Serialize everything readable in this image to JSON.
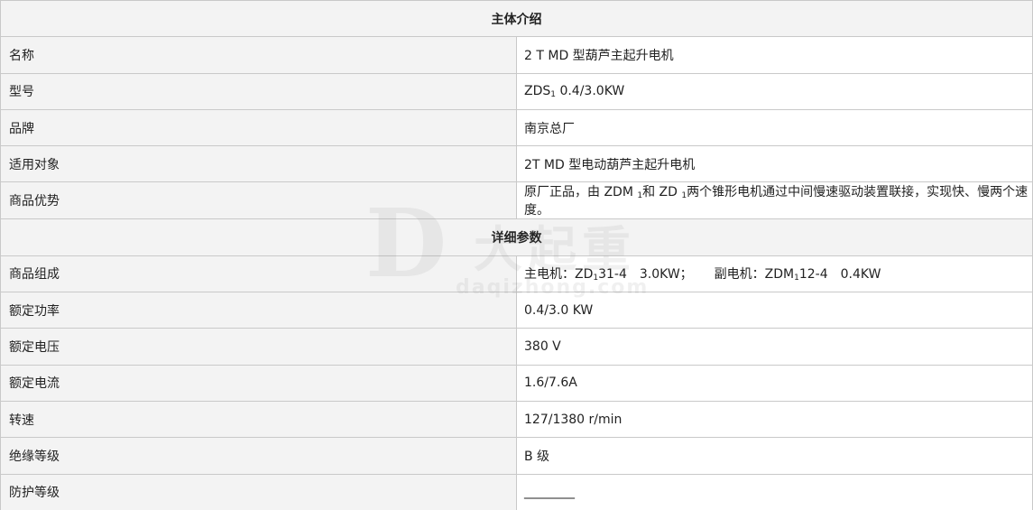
{
  "sections": {
    "intro_title": "主体介绍",
    "params_title": "详细参数"
  },
  "intro_rows": [
    {
      "label": "名称",
      "value": "2 T MD 型葫芦主起升电机"
    },
    {
      "label": "型号",
      "value_pre": "ZDS",
      "value_sub": "1",
      "value_post": " 0.4/3.0KW"
    },
    {
      "label": "品牌",
      "value": "南京总厂"
    },
    {
      "label": "适用对象",
      "value": "2T MD 型电动葫芦主起升电机"
    },
    {
      "label": "商品优势",
      "value_pre": "原厂正品，由 ZDM ",
      "value_sub": "1",
      "value_mid": "和 ZD ",
      "value_sub2": "1",
      "value_post": "两个锥形电机通过中间慢速驱动装置联接，实现快、慢两个速度。"
    }
  ],
  "param_rows": [
    {
      "label": "商品组成",
      "value_a_pre": "主电机：ZD",
      "value_a_sub": "1",
      "value_a_post": "31-4　3.0KW；",
      "value_b_pre": "副电机：ZDM",
      "value_b_sub": "1",
      "value_b_post": "12-4　0.4KW"
    },
    {
      "label": "额定功率",
      "value": "0.4/3.0 KW"
    },
    {
      "label": "额定电压",
      "value": "380 V"
    },
    {
      "label": "额定电流",
      "value": "1.6/7.6A"
    },
    {
      "label": "转速",
      "value": "127/1380 r/min"
    },
    {
      "label": "绝缘等级",
      "value": "B 级"
    },
    {
      "label": "防护等级",
      "value": "________"
    }
  ],
  "watermark": {
    "letter": "D",
    "text": "大起重",
    "url": "daqizhong.com"
  }
}
